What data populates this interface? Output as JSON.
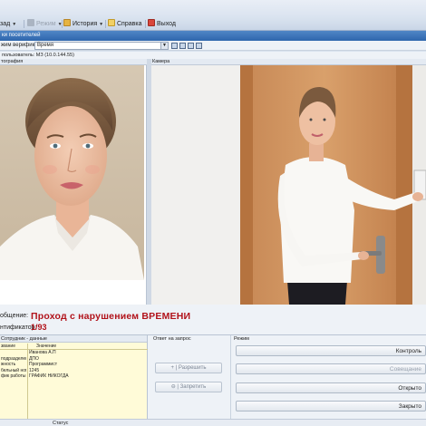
{
  "menu": {
    "items": [
      {
        "label": "зад",
        "caret": true
      },
      {
        "label": "Режим",
        "caret": true,
        "disabled": true
      },
      {
        "label": "История",
        "caret": true
      },
      {
        "label": "Справка",
        "caret": false
      },
      {
        "label": "Выход",
        "caret": false
      }
    ]
  },
  "title_strip": "ки посетителей",
  "toolbar": {
    "label": "жим верификации:",
    "mode_value": "Время"
  },
  "status_line": "пользователь: МЗ (10.0.144.55)",
  "panels": {
    "photo_title": "тография",
    "camera_title": "Камера"
  },
  "message": {
    "label": "общение:",
    "text": "Проход с нарушением ВРЕМЕНИ",
    "ident_label": "нтификатор:",
    "ident_value": "1/93"
  },
  "data_panel": {
    "title": "Сотрудник - данные",
    "col_name": "звание",
    "col_value": "Значение",
    "rows": [
      {
        "name": "",
        "value": "Иванова А.П"
      },
      {
        "name": "подразделение",
        "value": "ДПО"
      },
      {
        "name": "жность",
        "value": "Программист"
      },
      {
        "name": "бельный номер",
        "value": "1245"
      },
      {
        "name": "фик работы",
        "value": "ГРАФИК НИКОГДА"
      }
    ]
  },
  "answer_panel": {
    "title": "Ответ на запрос",
    "allow_label": "+ | Разрешить",
    "deny_label": "⊖ | Запретить"
  },
  "mode_panel": {
    "title": "Режим",
    "buttons": [
      "Контроль",
      "Совещание",
      "Открыто",
      "Закрыто"
    ]
  },
  "statusbar": {
    "label": "Статус"
  },
  "colors": {
    "alert_red": "#b1121a",
    "title_blue": "#2e66ad",
    "data_panel_bg": "#fffbd8"
  }
}
